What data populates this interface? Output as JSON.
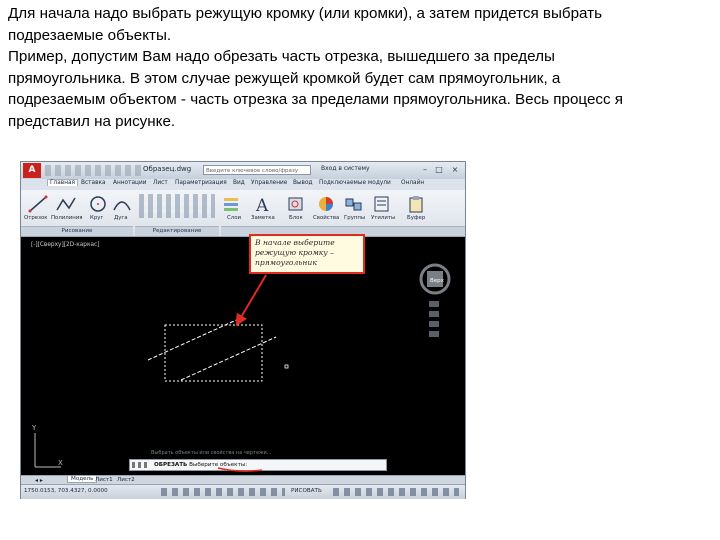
{
  "text": {
    "para1_line1": "Для начала надо выбрать режущую кромку (или кромки), а затем придется выбрать",
    "para1_line2": "подрезаемые объекты.",
    "para2_line1": "Пример, допустим Вам надо обрезать часть отрезка, вышедшего за пределы",
    "para2_line2": "прямоугольника. В этом случае режущей кромкой будет сам прямоугольник, а",
    "para2_line3": "подрезаемым объектом - часть отрезка за пределами прямоугольника. Весь процесс я",
    "para2_line4": "представил на рисунке."
  },
  "screenshot": {
    "app_logo": "A",
    "window_title": "Образец.dwg",
    "search_placeholder": "Введите ключевое слово/фразу",
    "signin": "Вход в систему",
    "window_buttons": [
      "–",
      "□",
      "×"
    ],
    "menu": [
      "Главная",
      "Вставка",
      "Аннотации",
      "Лист",
      "Параметризация",
      "Вид",
      "Управление",
      "Вывод",
      "Подключаемые модули",
      "Онлайн"
    ],
    "tools": [
      {
        "label": "Отрезок",
        "icon": "line-icon"
      },
      {
        "label": "Полилиния",
        "icon": "polyline-icon"
      },
      {
        "label": "Круг",
        "icon": "circle-icon"
      },
      {
        "label": "Дуга",
        "icon": "arc-icon"
      },
      {
        "label": "Слои",
        "icon": "layers-icon"
      },
      {
        "label": "Заметка",
        "icon": "text-icon"
      },
      {
        "label": "Блок",
        "icon": "block-icon"
      },
      {
        "label": "Свойства",
        "icon": "properties-icon"
      },
      {
        "label": "Группы",
        "icon": "groups-icon"
      },
      {
        "label": "Утилиты",
        "icon": "utilities-icon"
      },
      {
        "label": "Буфер",
        "icon": "clipboard-icon"
      }
    ],
    "panels": [
      "Рисование",
      "Редактирование"
    ],
    "viewport_label": "[-][Сверху][2D-каркас]",
    "viewcube_label": "Верх",
    "callout_line1": "В начале выберите",
    "callout_line2": "режущую кромку –",
    "callout_line3": "прямоугольник",
    "command_history": "Выбрать объекты или свойства на чертежи...",
    "command_prefix": "ОБРЕЗАТЬ",
    "command_text": "Выберите объекты:",
    "tabs": [
      "Модель",
      "Лист1",
      "Лист2"
    ],
    "coords": "1750.0153, 703.4327, 0.0000",
    "model_label": "РИСОВАТЬ"
  },
  "colors": {
    "callout_border": "#e02b20",
    "arrow": "#e02b20",
    "canvas": "#000000",
    "drawing": "#ffffff"
  }
}
